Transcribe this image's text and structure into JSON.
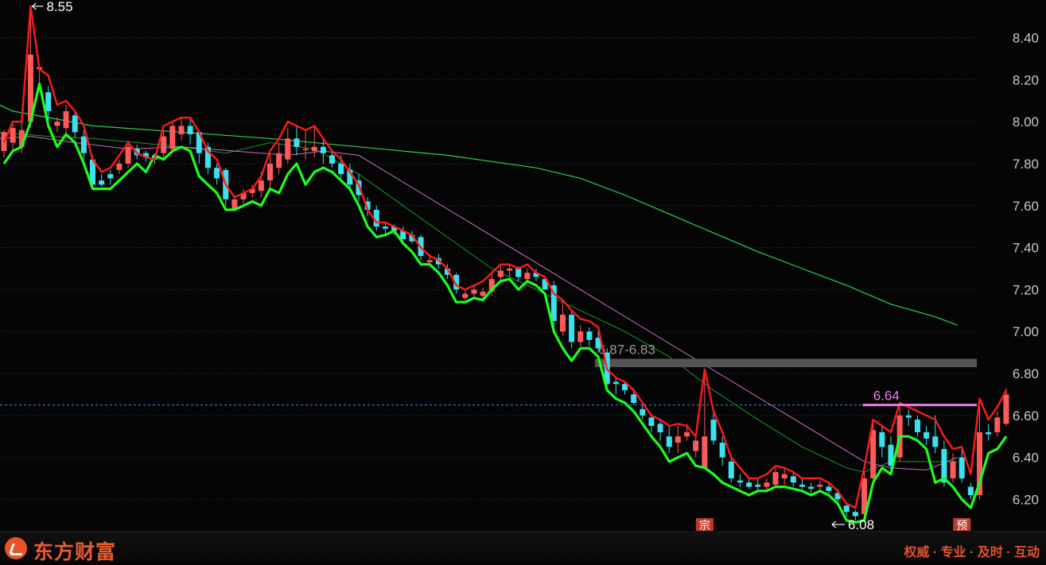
{
  "brand": {
    "name": "东方财富",
    "slogan": "权威 · 专业 · 及时 · 互动",
    "logo_icon": "eastmoney-logo-icon",
    "color": "#e8532a"
  },
  "chart_data": {
    "type": "candlestick",
    "ylim": [
      6.05,
      8.58
    ],
    "yticks": [
      "8.40",
      "8.20",
      "8.00",
      "7.80",
      "7.60",
      "7.40",
      "7.20",
      "7.00",
      "6.80",
      "6.60",
      "6.40",
      "6.20"
    ],
    "colors": {
      "up": "#ff5a5a",
      "down": "#3de0ee",
      "upper_band": "#ff1a1a",
      "lower_band": "#1bff1b",
      "ma_long": "#2ecf56",
      "ma_mid": "#1a9a2a",
      "ma_short": "#c770c7",
      "zone": "#555555",
      "pink_line": "#e680e8",
      "axis_text": "#c8c8c8"
    },
    "candles": [
      [
        7.86,
        7.95,
        7.83,
        7.96
      ],
      [
        7.9,
        7.97,
        7.86,
        7.99
      ],
      [
        7.88,
        7.96,
        7.85,
        8.0
      ],
      [
        8.0,
        8.32,
        7.97,
        8.55
      ],
      [
        8.25,
        8.26,
        8.18,
        8.27
      ],
      [
        8.14,
        8.05,
        8.01,
        8.17
      ],
      [
        7.98,
        8.0,
        7.95,
        8.02
      ],
      [
        7.97,
        8.05,
        7.94,
        8.08
      ],
      [
        8.03,
        7.95,
        7.92,
        8.05
      ],
      [
        7.93,
        7.85,
        7.82,
        7.96
      ],
      [
        7.82,
        7.7,
        7.69,
        7.84
      ],
      [
        7.72,
        7.7,
        7.69,
        7.75
      ],
      [
        7.75,
        7.73,
        7.7,
        7.77
      ],
      [
        7.77,
        7.8,
        7.75,
        7.82
      ],
      [
        7.8,
        7.88,
        7.78,
        7.91
      ],
      [
        7.87,
        7.84,
        7.82,
        7.89
      ],
      [
        7.85,
        7.83,
        7.81,
        7.86
      ],
      [
        7.84,
        7.82,
        7.8,
        7.85
      ],
      [
        7.85,
        7.93,
        7.82,
        7.96
      ],
      [
        7.87,
        7.98,
        7.85,
        8.0
      ],
      [
        7.94,
        7.98,
        7.91,
        8.02
      ],
      [
        7.98,
        7.94,
        7.89,
        8.02
      ],
      [
        7.95,
        7.85,
        7.8,
        7.96
      ],
      [
        7.88,
        7.78,
        7.75,
        7.9
      ],
      [
        7.78,
        7.73,
        7.7,
        7.8
      ],
      [
        7.77,
        7.63,
        7.6,
        7.78
      ],
      [
        7.58,
        7.63,
        7.58,
        7.65
      ],
      [
        7.63,
        7.66,
        7.61,
        7.68
      ],
      [
        7.66,
        7.68,
        7.64,
        7.7
      ],
      [
        7.67,
        7.72,
        7.64,
        7.76
      ],
      [
        7.72,
        7.8,
        7.68,
        7.85
      ],
      [
        7.78,
        7.85,
        7.75,
        7.9
      ],
      [
        7.82,
        7.92,
        7.8,
        7.97
      ],
      [
        7.92,
        7.88,
        7.84,
        7.98
      ],
      [
        7.87,
        7.87,
        7.82,
        7.96
      ],
      [
        7.86,
        7.88,
        7.83,
        7.98
      ],
      [
        7.88,
        7.85,
        7.8,
        7.92
      ],
      [
        7.84,
        7.8,
        7.78,
        7.86
      ],
      [
        7.8,
        7.75,
        7.73,
        7.84
      ],
      [
        7.77,
        7.7,
        7.68,
        7.8
      ],
      [
        7.72,
        7.65,
        7.62,
        7.75
      ],
      [
        7.62,
        7.58,
        7.55,
        7.64
      ],
      [
        7.58,
        7.5,
        7.48,
        7.6
      ],
      [
        7.5,
        7.49,
        7.46,
        7.52
      ],
      [
        7.5,
        7.48,
        7.46,
        7.51
      ],
      [
        7.48,
        7.44,
        7.42,
        7.5
      ],
      [
        7.46,
        7.43,
        7.42,
        7.48
      ],
      [
        7.45,
        7.36,
        7.34,
        7.46
      ],
      [
        7.33,
        7.34,
        7.32,
        7.37
      ],
      [
        7.35,
        7.32,
        7.3,
        7.37
      ],
      [
        7.3,
        7.27,
        7.25,
        7.32
      ],
      [
        7.27,
        7.2,
        7.18,
        7.28
      ],
      [
        7.16,
        7.18,
        7.15,
        7.2
      ],
      [
        7.18,
        7.2,
        7.16,
        7.22
      ],
      [
        7.17,
        7.19,
        7.15,
        7.21
      ],
      [
        7.19,
        7.25,
        7.17,
        7.28
      ],
      [
        7.26,
        7.29,
        7.24,
        7.32
      ],
      [
        7.29,
        7.3,
        7.26,
        7.32
      ],
      [
        7.3,
        7.26,
        7.24,
        7.31
      ],
      [
        7.25,
        7.28,
        7.23,
        7.3
      ],
      [
        7.28,
        7.26,
        7.24,
        7.3
      ],
      [
        7.25,
        7.2,
        7.2,
        7.26
      ],
      [
        7.22,
        7.05,
        7.0,
        7.24
      ],
      [
        7.0,
        7.08,
        6.98,
        7.15
      ],
      [
        7.08,
        6.95,
        6.92,
        7.1
      ],
      [
        6.95,
        7.0,
        6.93,
        7.03
      ],
      [
        7.0,
        6.96,
        6.93,
        7.02
      ],
      [
        6.97,
        6.92,
        6.9,
        7.0
      ],
      [
        6.9,
        6.75,
        6.72,
        6.92
      ],
      [
        6.76,
        6.75,
        6.7,
        6.78
      ],
      [
        6.75,
        6.72,
        6.7,
        6.76
      ],
      [
        6.7,
        6.66,
        6.65,
        6.73
      ],
      [
        6.63,
        6.6,
        6.58,
        6.66
      ],
      [
        6.59,
        6.55,
        6.52,
        6.6
      ],
      [
        6.56,
        6.52,
        6.48,
        6.58
      ],
      [
        6.5,
        6.45,
        6.42,
        6.55
      ],
      [
        6.47,
        6.5,
        6.42,
        6.55
      ],
      [
        6.5,
        6.52,
        6.48,
        6.56
      ],
      [
        6.43,
        6.48,
        6.4,
        6.5
      ],
      [
        6.35,
        6.5,
        6.35,
        6.82
      ],
      [
        6.58,
        6.48,
        6.46,
        6.62
      ],
      [
        6.47,
        6.4,
        6.36,
        6.5
      ],
      [
        6.38,
        6.3,
        6.28,
        6.4
      ],
      [
        6.29,
        6.28,
        6.26,
        6.32
      ],
      [
        6.28,
        6.26,
        6.25,
        6.3
      ],
      [
        6.27,
        6.26,
        6.24,
        6.3
      ],
      [
        6.26,
        6.28,
        6.24,
        6.3
      ],
      [
        6.27,
        6.33,
        6.26,
        6.35
      ],
      [
        6.3,
        6.32,
        6.27,
        6.35
      ],
      [
        6.31,
        6.28,
        6.26,
        6.33
      ],
      [
        6.27,
        6.26,
        6.25,
        6.3
      ],
      [
        6.26,
        6.25,
        6.23,
        6.28
      ],
      [
        6.26,
        6.27,
        6.24,
        6.29
      ],
      [
        6.26,
        6.24,
        6.23,
        6.28
      ],
      [
        6.23,
        6.2,
        6.19,
        6.25
      ],
      [
        6.17,
        6.14,
        6.12,
        6.18
      ],
      [
        6.14,
        6.12,
        6.1,
        6.15
      ],
      [
        6.13,
        6.3,
        6.1,
        6.35
      ],
      [
        6.3,
        6.53,
        6.28,
        6.58
      ],
      [
        6.52,
        6.45,
        6.4,
        6.55
      ],
      [
        6.46,
        6.36,
        6.34,
        6.5
      ],
      [
        6.4,
        6.6,
        6.38,
        6.64
      ],
      [
        6.6,
        6.59,
        6.55,
        6.63
      ],
      [
        6.58,
        6.52,
        6.5,
        6.6
      ],
      [
        6.52,
        6.49,
        6.46,
        6.55
      ],
      [
        6.5,
        6.45,
        6.42,
        6.6
      ],
      [
        6.44,
        6.28,
        6.26,
        6.48
      ],
      [
        6.3,
        6.38,
        6.28,
        6.42
      ],
      [
        6.4,
        6.3,
        6.28,
        6.45
      ],
      [
        6.26,
        6.22,
        6.2,
        6.28
      ],
      [
        6.22,
        6.52,
        6.2,
        6.67
      ],
      [
        6.52,
        6.51,
        6.48,
        6.56
      ],
      [
        6.52,
        6.59,
        6.5,
        6.62
      ],
      [
        6.56,
        6.7,
        6.55,
        6.73
      ]
    ],
    "upper_band": [
      7.9,
      8.0,
      8.0,
      8.55,
      8.25,
      8.22,
      8.08,
      8.1,
      8.05,
      7.98,
      7.82,
      7.76,
      7.78,
      7.84,
      7.9,
      7.85,
      7.83,
      7.82,
      7.98,
      8.0,
      8.02,
      8.02,
      7.95,
      7.86,
      7.82,
      7.7,
      7.64,
      7.66,
      7.68,
      7.74,
      7.86,
      7.92,
      8.0,
      7.98,
      7.96,
      7.98,
      7.92,
      7.86,
      7.82,
      7.76,
      7.7,
      7.58,
      7.52,
      7.52,
      7.5,
      7.48,
      7.46,
      7.4,
      7.36,
      7.34,
      7.3,
      7.22,
      7.2,
      7.22,
      7.24,
      7.28,
      7.32,
      7.32,
      7.3,
      7.32,
      7.28,
      7.26,
      7.18,
      7.15,
      7.1,
      7.06,
      7.05,
      7.02,
      6.82,
      6.78,
      6.76,
      6.72,
      6.66,
      6.6,
      6.58,
      6.55,
      6.56,
      6.55,
      6.5,
      6.82,
      6.62,
      6.52,
      6.4,
      6.35,
      6.3,
      6.3,
      6.32,
      6.36,
      6.35,
      6.33,
      6.3,
      6.3,
      6.3,
      6.28,
      6.24,
      6.18,
      6.16,
      6.35,
      6.58,
      6.55,
      6.52,
      6.66,
      6.64,
      6.62,
      6.6,
      6.58,
      6.5,
      6.44,
      6.45,
      6.32,
      6.68,
      6.58,
      6.64,
      6.72
    ],
    "lower_band": [
      7.8,
      7.86,
      7.88,
      8.0,
      8.18,
      7.98,
      7.88,
      7.94,
      7.9,
      7.8,
      7.68,
      7.68,
      7.68,
      7.72,
      7.76,
      7.8,
      7.76,
      7.84,
      7.82,
      7.86,
      7.88,
      7.86,
      7.74,
      7.7,
      7.66,
      7.58,
      7.58,
      7.6,
      7.62,
      7.6,
      7.68,
      7.66,
      7.75,
      7.8,
      7.7,
      7.76,
      7.78,
      7.76,
      7.72,
      7.68,
      7.6,
      7.5,
      7.45,
      7.46,
      7.48,
      7.42,
      7.38,
      7.32,
      7.32,
      7.28,
      7.22,
      7.14,
      7.14,
      7.16,
      7.15,
      7.2,
      7.24,
      7.25,
      7.2,
      7.24,
      7.22,
      7.18,
      7.0,
      6.92,
      6.86,
      6.92,
      6.92,
      6.88,
      6.72,
      6.68,
      6.66,
      6.62,
      6.56,
      6.5,
      6.45,
      6.38,
      6.4,
      6.42,
      6.36,
      6.35,
      6.32,
      6.28,
      6.26,
      6.24,
      6.22,
      6.24,
      6.24,
      6.26,
      6.26,
      6.25,
      6.24,
      6.22,
      6.24,
      6.22,
      6.18,
      6.1,
      6.09,
      6.1,
      6.28,
      6.35,
      6.32,
      6.5,
      6.5,
      6.48,
      6.44,
      6.28,
      6.3,
      6.26,
      6.2,
      6.16,
      6.28,
      6.42,
      6.44,
      6.5
    ],
    "ma_long": [
      [
        -0.5,
        8.08
      ],
      [
        1,
        8.05
      ],
      [
        5,
        8.02
      ],
      [
        10,
        7.98
      ],
      [
        20,
        7.95
      ],
      [
        30,
        7.92
      ],
      [
        40,
        7.88
      ],
      [
        50,
        7.84
      ],
      [
        60,
        7.78
      ],
      [
        65,
        7.73
      ],
      [
        70,
        7.65
      ],
      [
        75,
        7.56
      ],
      [
        80,
        7.47
      ],
      [
        85,
        7.38
      ],
      [
        90,
        7.3
      ],
      [
        95,
        7.22
      ],
      [
        100,
        7.13
      ],
      [
        105,
        7.07
      ],
      [
        107.5,
        7.03
      ]
    ],
    "ma_mid": [
      [
        -0.5,
        7.95
      ],
      [
        5,
        7.93
      ],
      [
        10,
        7.92
      ],
      [
        15,
        7.9
      ],
      [
        20,
        7.88
      ],
      [
        25,
        7.85
      ],
      [
        30,
        7.9
      ],
      [
        35,
        7.87
      ],
      [
        40,
        7.75
      ],
      [
        45,
        7.6
      ],
      [
        50,
        7.45
      ],
      [
        55,
        7.3
      ],
      [
        60,
        7.2
      ],
      [
        65,
        7.1
      ],
      [
        70,
        7.0
      ],
      [
        75,
        6.88
      ],
      [
        80,
        6.72
      ],
      [
        85,
        6.58
      ],
      [
        90,
        6.45
      ],
      [
        95,
        6.35
      ],
      [
        97,
        6.33
      ],
      [
        100,
        6.38
      ],
      [
        105,
        6.38
      ],
      [
        107.5,
        6.38
      ]
    ],
    "ma_short": [
      [
        -0.5,
        7.92
      ],
      [
        3,
        7.93
      ],
      [
        8,
        7.9
      ],
      [
        14,
        7.87
      ],
      [
        20,
        7.88
      ],
      [
        26,
        7.86
      ],
      [
        32,
        7.84
      ],
      [
        36,
        7.86
      ],
      [
        40,
        7.84
      ],
      [
        97,
        6.38
      ],
      [
        100,
        6.35
      ],
      [
        104,
        6.34
      ],
      [
        107.5,
        6.4
      ]
    ],
    "current_price": 6.65,
    "zone": {
      "label": "6.87-6.83",
      "high": 6.87,
      "low": 6.83
    },
    "pink_level": {
      "label": "6.64",
      "value": 6.65
    },
    "high_label": "8.55",
    "low_label": "6.08",
    "markers": [
      {
        "label": "宗",
        "index": 79
      },
      {
        "label": "预",
        "index": 108
      }
    ]
  }
}
